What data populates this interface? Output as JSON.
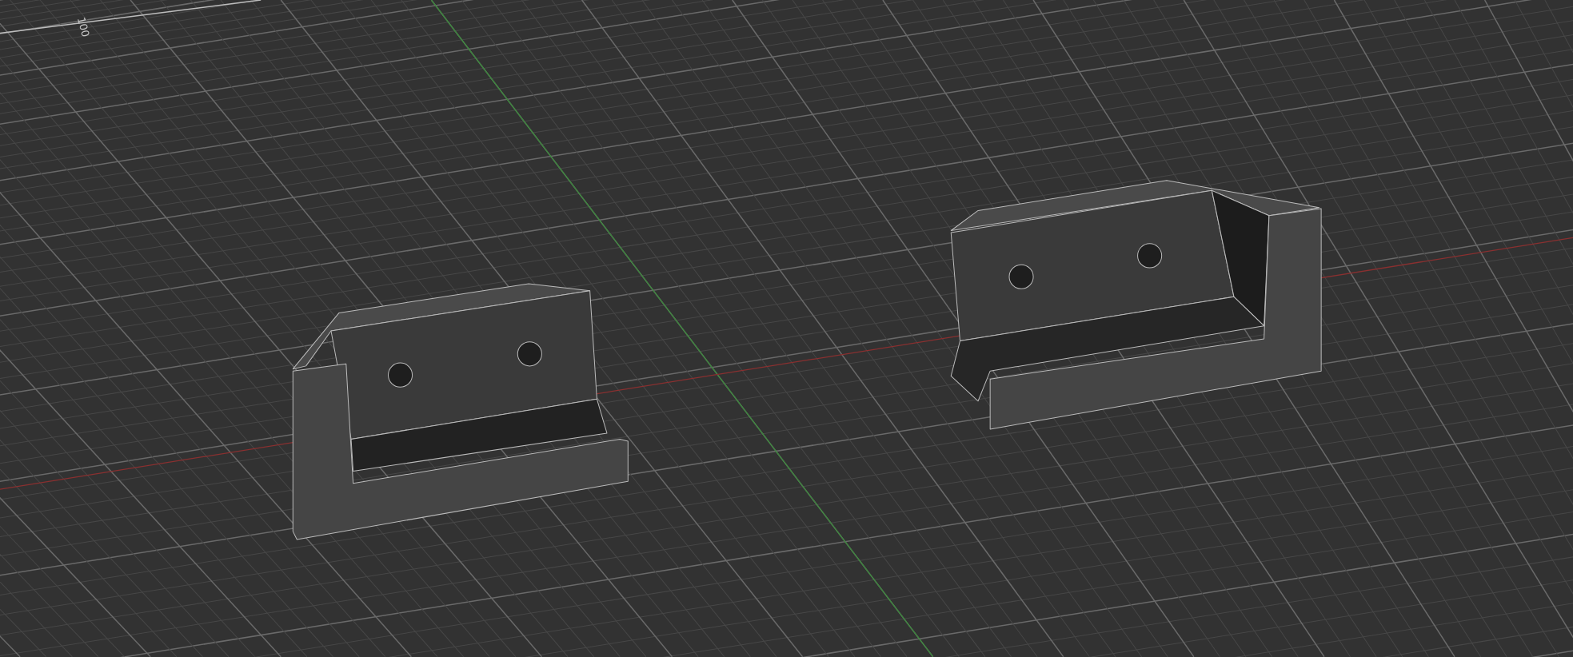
{
  "viewport": {
    "axis_labels": [
      "100"
    ]
  }
}
